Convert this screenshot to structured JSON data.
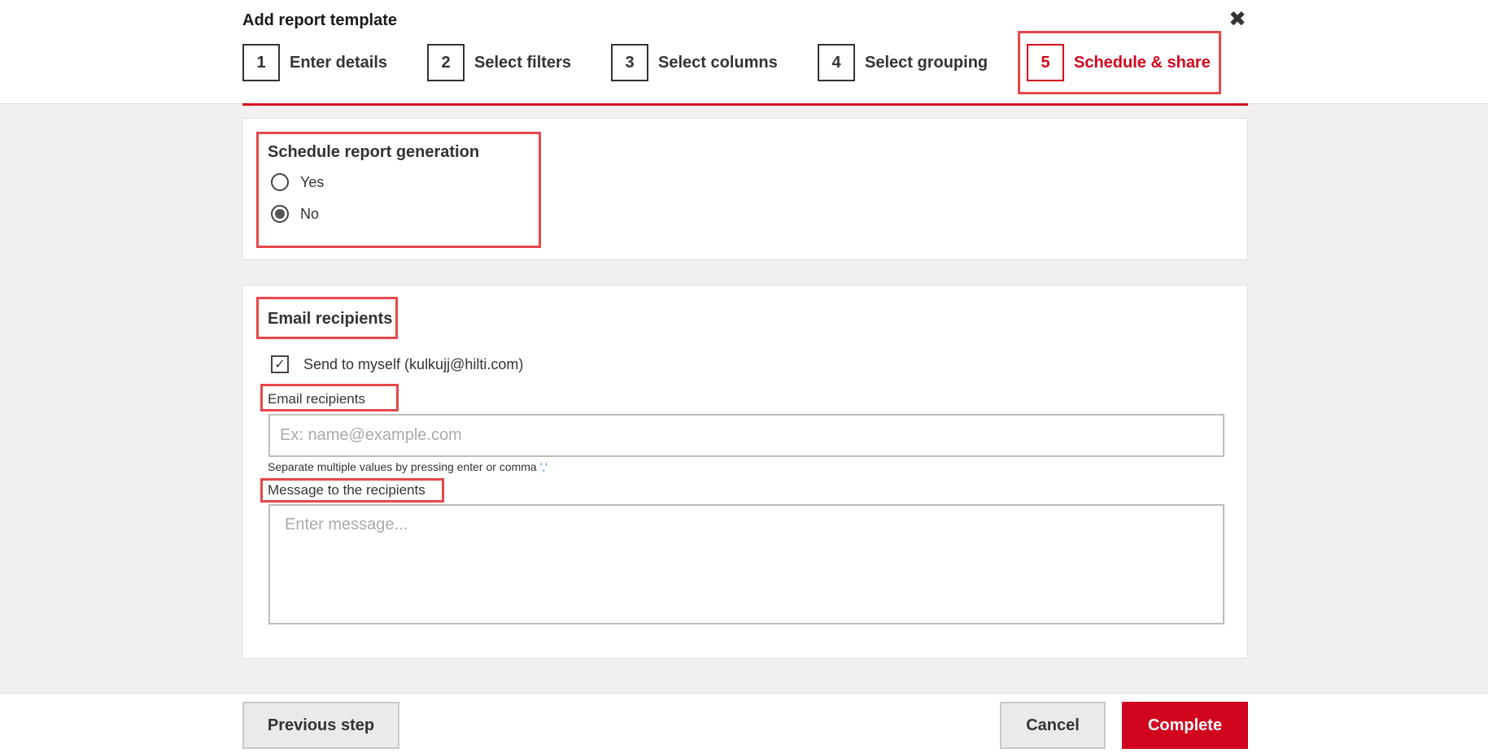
{
  "dialog": {
    "title": "Add report template",
    "close_icon": "close-icon"
  },
  "steps": [
    {
      "number": "1",
      "label": "Enter details"
    },
    {
      "number": "2",
      "label": "Select filters"
    },
    {
      "number": "3",
      "label": "Select columns"
    },
    {
      "number": "4",
      "label": "Select grouping"
    },
    {
      "number": "5",
      "label": "Schedule & share",
      "active": true
    }
  ],
  "schedule": {
    "title": "Schedule report generation",
    "options": [
      {
        "label": "Yes",
        "selected": false
      },
      {
        "label": "No",
        "selected": true
      }
    ]
  },
  "email": {
    "title": "Email recipients",
    "send_to_myself": {
      "label": "Send to myself (kulkujj@hilti.com)",
      "checked": true
    },
    "recipients_label": "Email recipients",
    "recipients_placeholder": "Ex: name@example.com",
    "help_text": "Separate multiple values by pressing enter or comma",
    "help_comma": "','",
    "message_label": "Message to the recipients",
    "message_placeholder": "Enter message..."
  },
  "footer": {
    "previous": "Previous step",
    "cancel": "Cancel",
    "complete": "Complete"
  },
  "colors": {
    "accent": "#d2051e",
    "highlight": "#e8474c"
  }
}
